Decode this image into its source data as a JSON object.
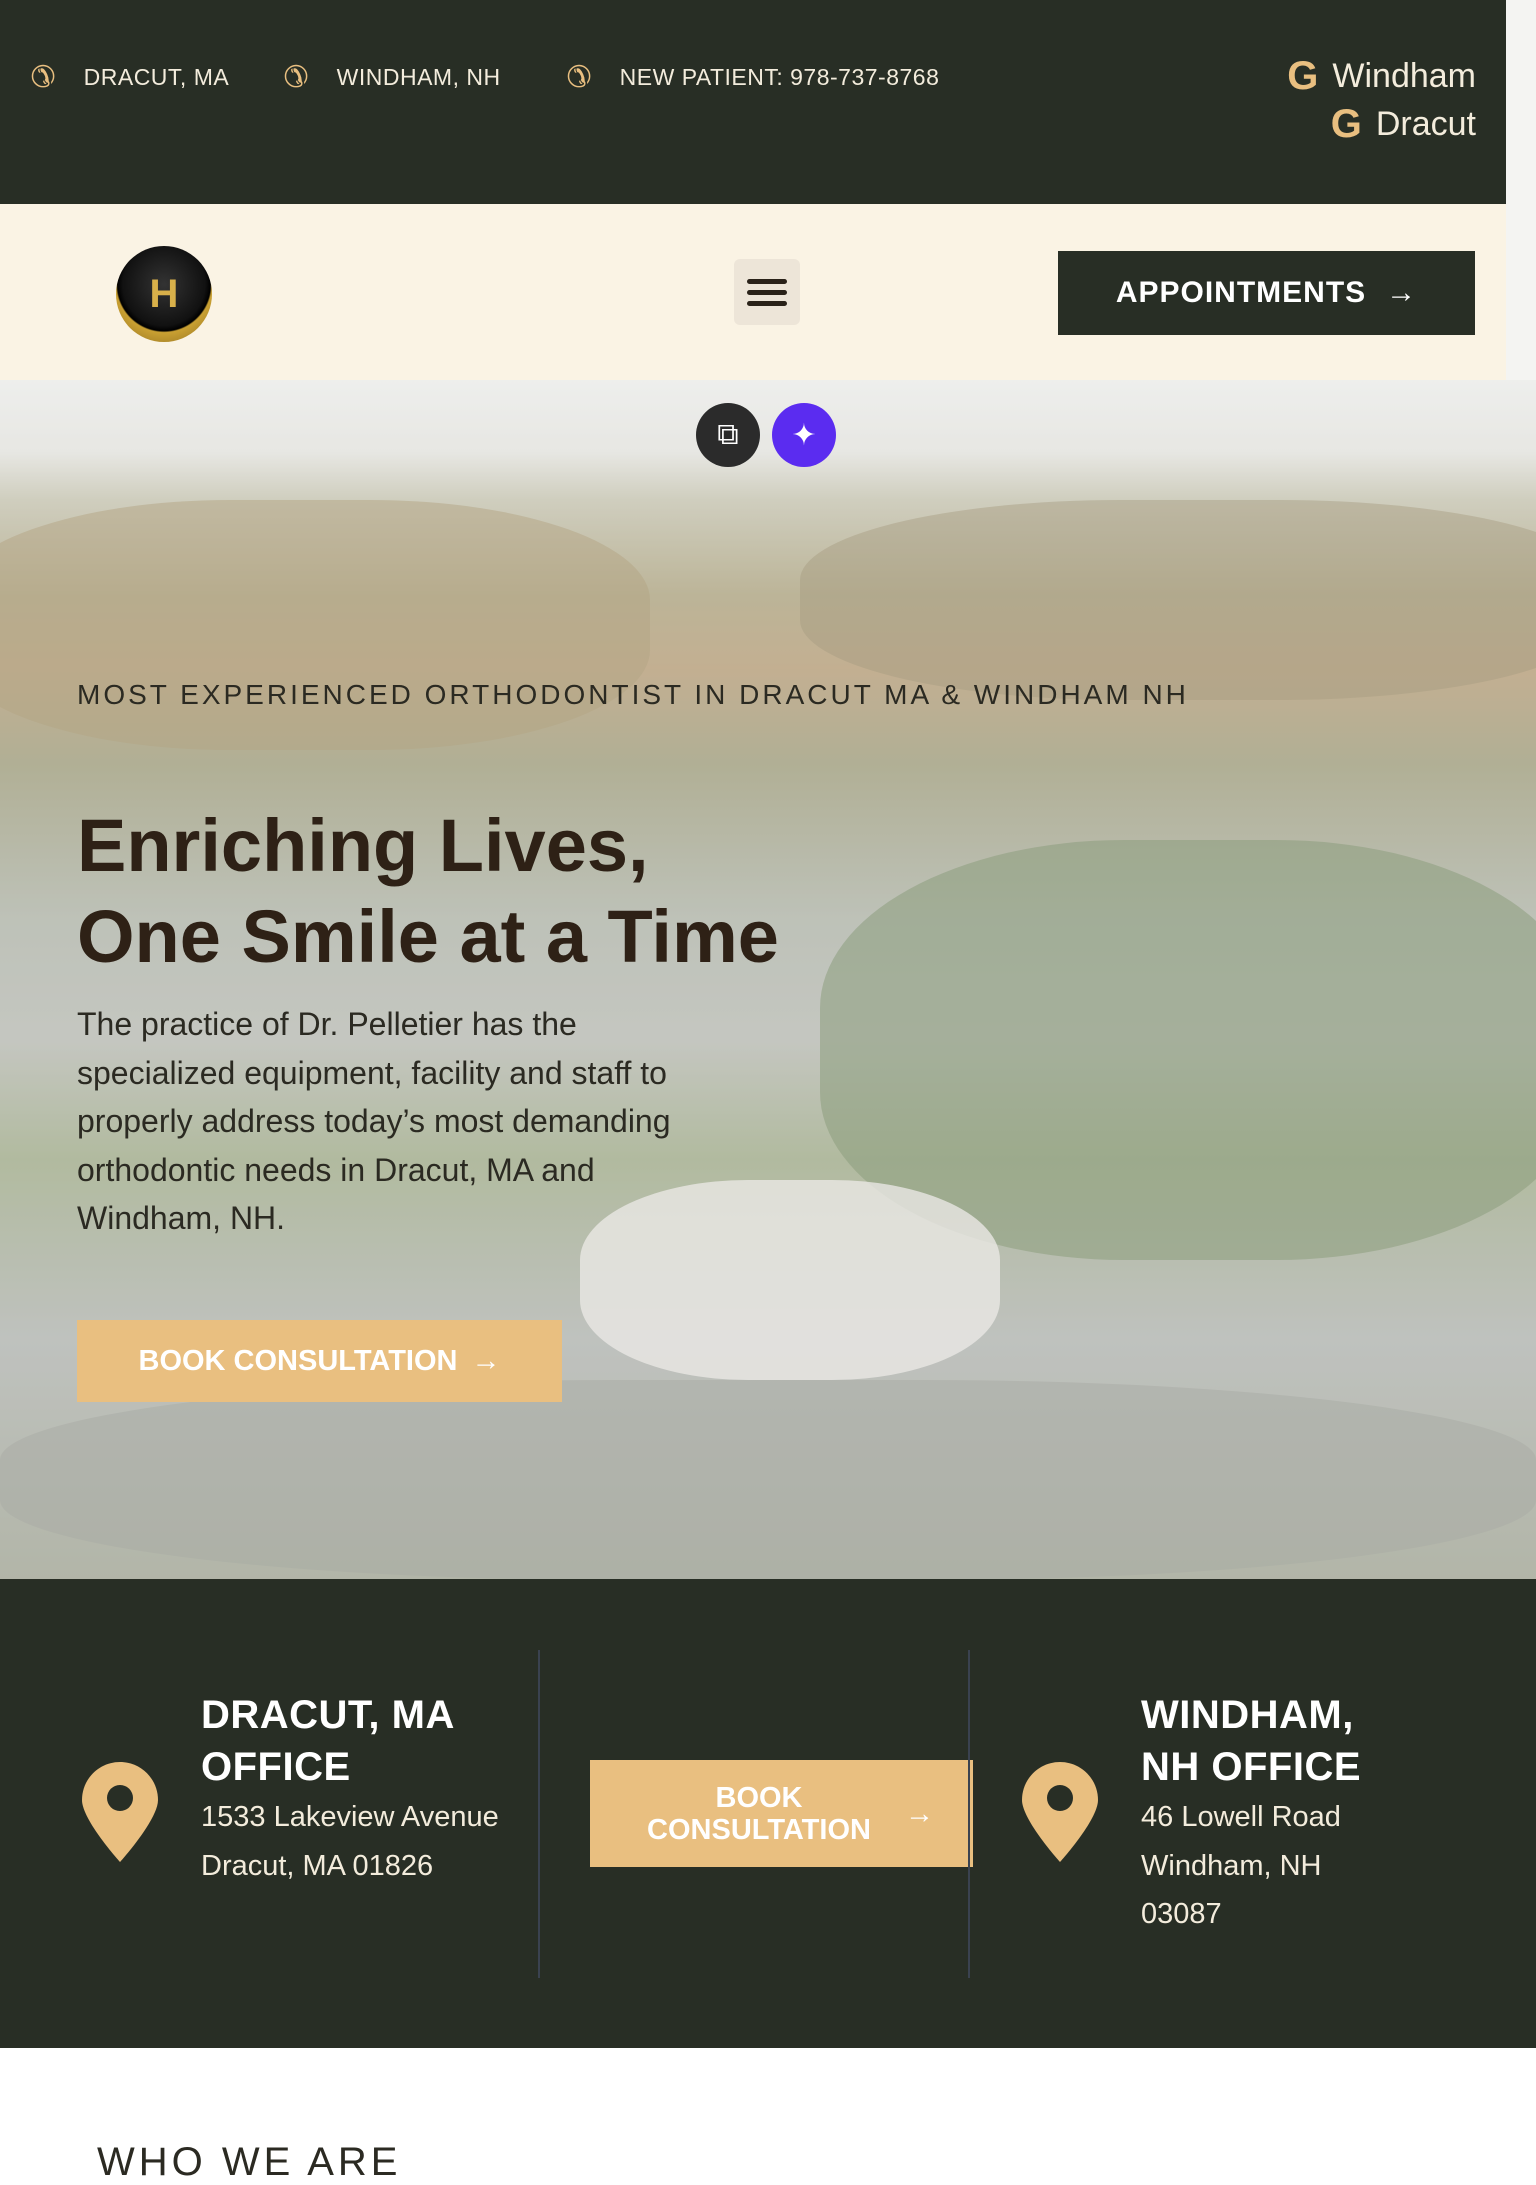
{
  "topbar": {
    "contacts": [
      {
        "label": "DRACUT, MA",
        "icon": "phone-icon"
      },
      {
        "label": "WINDHAM, NH",
        "icon": "phone-icon"
      },
      {
        "label": "NEW PATIENT: 978-737-8768",
        "icon": "phone-icon"
      }
    ],
    "google_links": [
      {
        "label": "Windham",
        "icon": "google-icon"
      },
      {
        "label": "Dracut",
        "icon": "google-icon"
      }
    ]
  },
  "nav": {
    "logo_text": "H",
    "appointments_label": "APPOINTMENTS",
    "arrow": "→"
  },
  "hero": {
    "eyebrow": "MOST EXPERIENCED ORTHODONTIST IN DRACUT MA & WINDHAM NH",
    "title_line1": "Enriching Lives,",
    "title_line2": "One Smile at a Time",
    "paragraph": "The practice of Dr. Pelletier has the specialized equipment, facility and staff to properly address today’s most demanding orthodontic needs in Dracut, MA and Windham, NH.",
    "cta_label": "BOOK CONSULTATION",
    "arrow": "→"
  },
  "offices": {
    "left": {
      "title": "DRACUT, MA OFFICE",
      "address": "1533 Lakeview Avenue Dracut, MA 01826"
    },
    "cta_label": "BOOK CONSULTATION",
    "arrow": "→",
    "right": {
      "title": "WINDHAM, NH OFFICE",
      "address": "46 Lowell Road Windham, NH 03087"
    }
  },
  "who": {
    "heading": "WHO WE ARE"
  },
  "colors": {
    "dark": "#282e25",
    "gold": "#e9bf80",
    "cream": "#faf3e4",
    "purple": "#5b2cf0"
  }
}
